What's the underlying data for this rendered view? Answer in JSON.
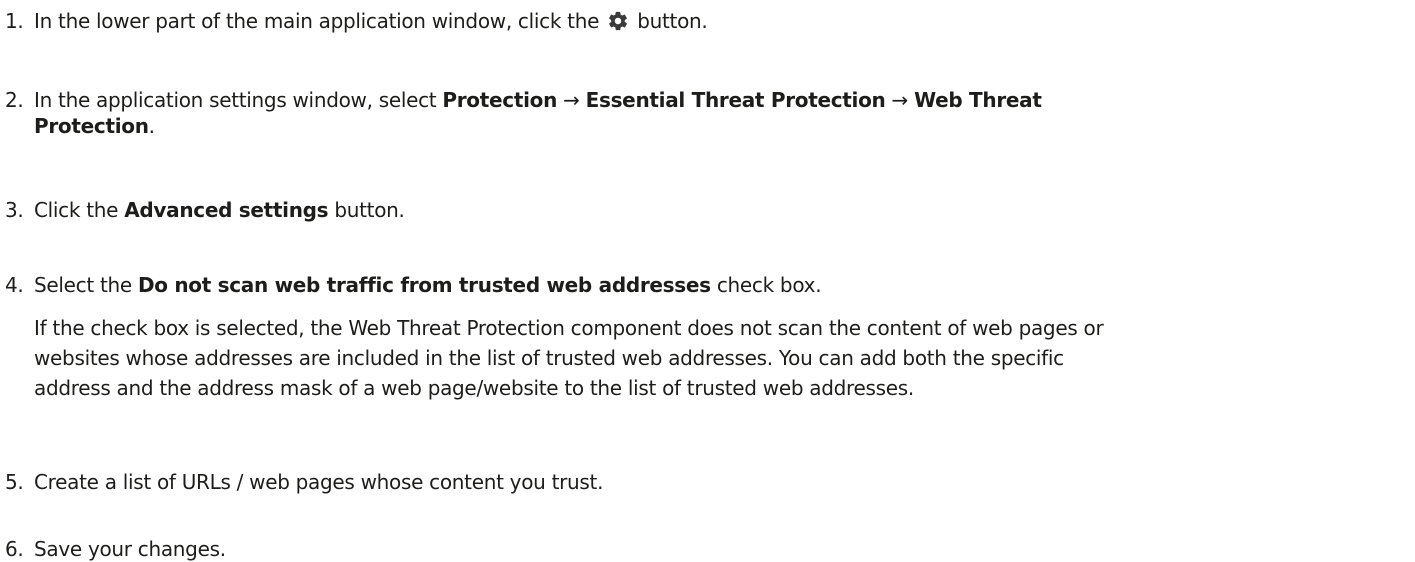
{
  "steps": [
    {
      "number": "1.",
      "before": "In the lower part of the main application window, click the",
      "icon": "gear-icon",
      "after": "button."
    },
    {
      "number": "2.",
      "text1": "In the application settings window, select ",
      "bold1": "Protection",
      "arrow1": " → ",
      "bold2": "Essential Threat Protection",
      "arrow2": " → ",
      "bold3": "Web Threat",
      "bold4": "Protection",
      "end": "."
    },
    {
      "number": "3.",
      "text1": "Click the ",
      "bold1": "Advanced settings",
      "text2": " button."
    },
    {
      "number": "4.",
      "text1": "Select the ",
      "bold1": "Do not scan web traffic from trusted web addresses",
      "text2": " check box.",
      "note_line1": "If the check box is selected, the Web Threat Protection component does not scan the content of web pages or",
      "note_line2": "websites whose addresses are included in the list of trusted web addresses. You can add both the specific",
      "note_line3": "address and the address mask of a web page/website to the list of trusted web addresses."
    },
    {
      "number": "5.",
      "text1": "Create a list of URLs / web pages whose content you trust."
    },
    {
      "number": "6.",
      "text1": "Save your changes."
    }
  ]
}
